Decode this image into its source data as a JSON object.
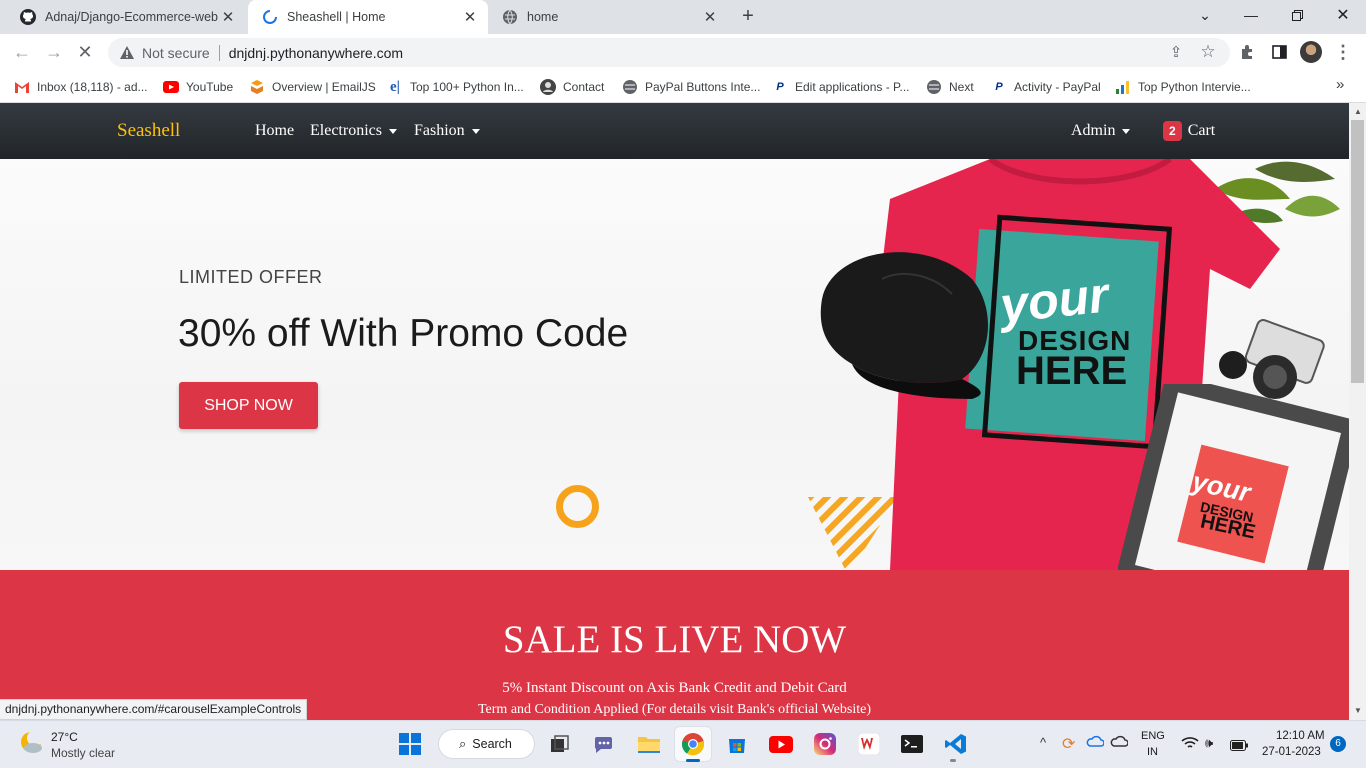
{
  "browser": {
    "tabs": [
      {
        "title": "Adnaj/Django-Ecommerce-website",
        "favicon": "github-icon"
      },
      {
        "title": "Sheashell | Home",
        "favicon": "loading-spinner-icon"
      },
      {
        "title": "home",
        "favicon": "globe-icon"
      }
    ],
    "new_tab": "+",
    "security_label": "Not secure",
    "url": "dnjdnj.pythonanywhere.com",
    "status_url": "dnjdnj.pythonanywhere.com/#carouselExampleControls",
    "bookmarks": [
      {
        "label": "Inbox (18,118) - ad...",
        "icon": "gmail-icon"
      },
      {
        "label": "YouTube",
        "icon": "youtube-icon"
      },
      {
        "label": "Overview | EmailJS",
        "icon": "emailjs-icon"
      },
      {
        "label": "Top 100+ Python In...",
        "icon": "edureka-icon"
      },
      {
        "label": "Contact",
        "icon": "contact-icon"
      },
      {
        "label": "PayPal Buttons Inte...",
        "icon": "globe-icon"
      },
      {
        "label": "Edit applications - P...",
        "icon": "paypal-icon"
      },
      {
        "label": "Next",
        "icon": "globe-icon"
      },
      {
        "label": "Activity - PayPal",
        "icon": "paypal-icon"
      },
      {
        "label": "Top Python Intervie...",
        "icon": "chart-icon"
      }
    ],
    "bookmarks_overflow": "»"
  },
  "site": {
    "brand": "Seashell",
    "nav": {
      "home": "Home",
      "electronics": "Electronics",
      "fashion": "Fashion",
      "admin": "Admin",
      "cart_count": "2",
      "cart": "Cart"
    },
    "hero": {
      "eyebrow": "LIMITED OFFER",
      "headline": "30% off With Promo Code",
      "cta": "SHOP NOW",
      "shirt_text_1": "your",
      "shirt_text_2": "DESIGN",
      "shirt_text_3": "HERE",
      "frame_text_1": "your",
      "frame_text_2": "DESIGN",
      "frame_text_3": "HERE"
    },
    "sale": {
      "title": "SALE IS LIVE NOW",
      "line1": "5% Instant Discount on Axis Bank Credit and Debit Card",
      "line2": "Term and Condition Applied (For details visit Bank's official Website)"
    }
  },
  "taskbar": {
    "weather_temp": "27°C",
    "weather_desc": "Mostly clear",
    "search": "Search",
    "lang_1": "ENG",
    "lang_2": "IN",
    "time": "12:10 AM",
    "date": "27-01-2023",
    "notifications": "6"
  },
  "colors": {
    "brand": "#ffc107",
    "danger": "#dc3545",
    "nav_dark": "#212529"
  }
}
